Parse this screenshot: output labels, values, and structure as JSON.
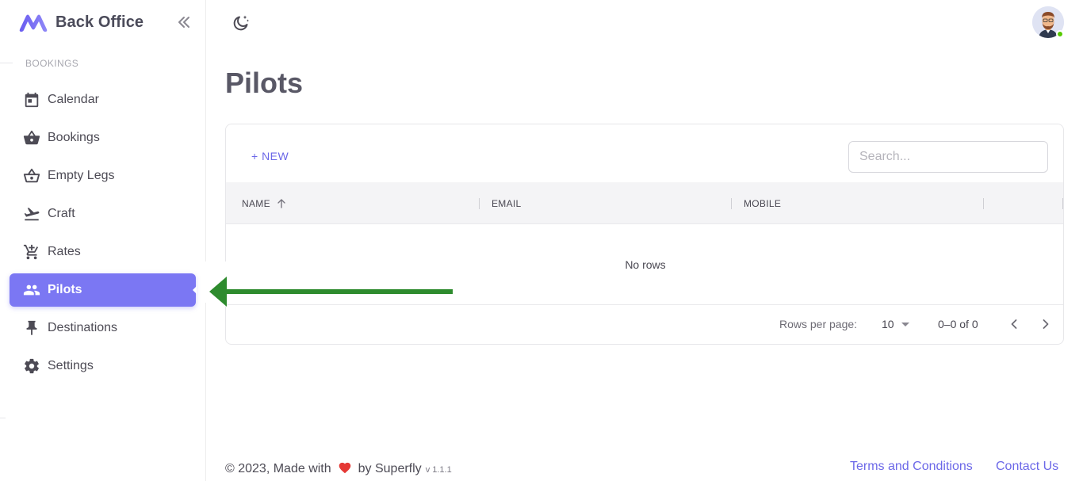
{
  "brand": {
    "title": "Back Office"
  },
  "sidebar": {
    "section_label": "BOOKINGS",
    "items": [
      {
        "label": "Calendar",
        "icon": "calendar-icon",
        "active": false
      },
      {
        "label": "Bookings",
        "icon": "basket-icon",
        "active": false
      },
      {
        "label": "Empty Legs",
        "icon": "basket-outline-icon",
        "active": false
      },
      {
        "label": "Craft",
        "icon": "airplane-icon",
        "active": false
      },
      {
        "label": "Rates",
        "icon": "cart-icon",
        "active": false
      },
      {
        "label": "Pilots",
        "icon": "users-icon",
        "active": true
      },
      {
        "label": "Destinations",
        "icon": "pin-icon",
        "active": false
      },
      {
        "label": "Settings",
        "icon": "gear-icon",
        "active": false
      }
    ]
  },
  "page": {
    "title": "Pilots"
  },
  "toolbar": {
    "new_label": "+ NEW",
    "search_placeholder": "Search..."
  },
  "table": {
    "columns": [
      "NAME",
      "EMAIL",
      "MOBILE"
    ],
    "sorted_column": "NAME",
    "sort_direction": "ascending",
    "empty_text": "No rows"
  },
  "pagination": {
    "rows_per_page_label": "Rows per page:",
    "rows_per_page": "10",
    "range": "0–0 of 0"
  },
  "footer": {
    "copyright": "© 2023, Made with",
    "by": "by Superfly",
    "version": "v 1.1.1",
    "links": [
      "Terms and Conditions",
      "Contact Us"
    ]
  },
  "colors": {
    "accent": "#7b77f3",
    "link": "#6c68e8",
    "online": "#56ca00",
    "annotation_arrow": "#2e8b2e",
    "heart": "#e53935"
  }
}
